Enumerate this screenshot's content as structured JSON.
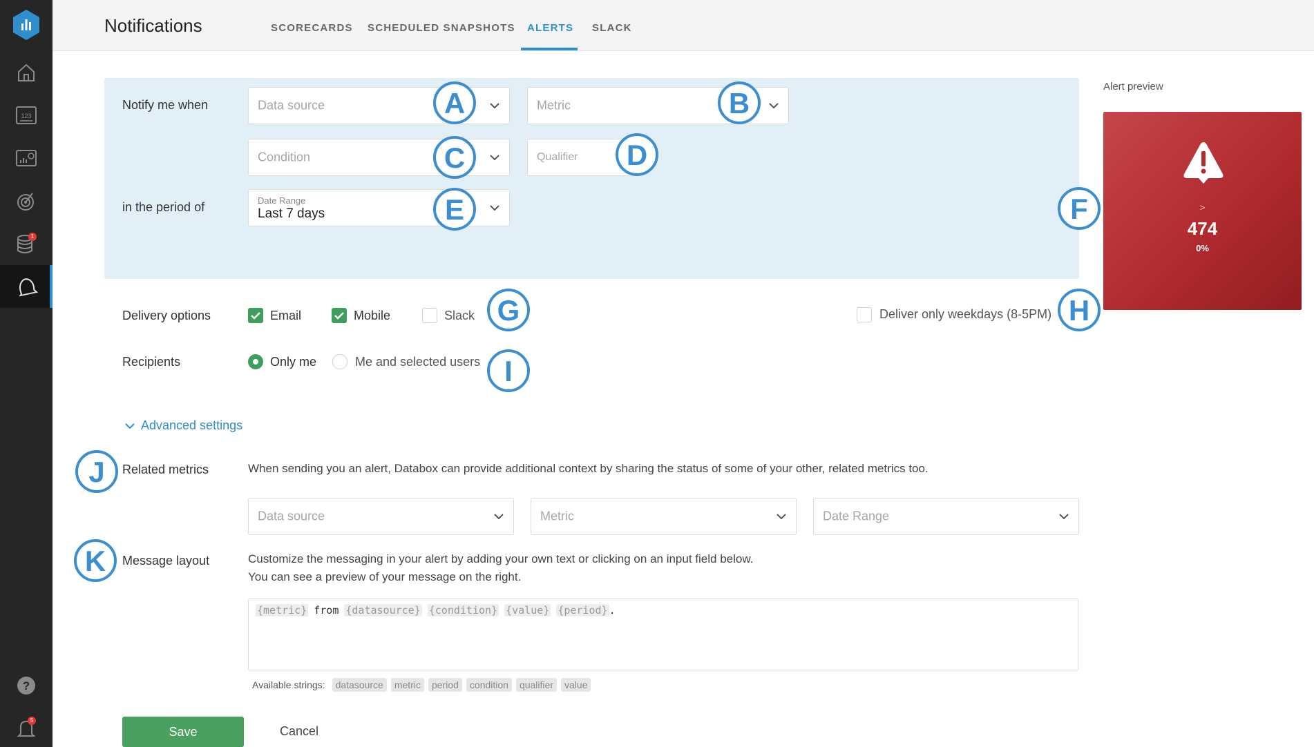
{
  "header": {
    "title": "Notifications",
    "tabs": [
      {
        "label": "SCORECARDS",
        "active": false
      },
      {
        "label": "SCHEDULED SNAPSHOTS",
        "active": false
      },
      {
        "label": "ALERTS",
        "active": true
      },
      {
        "label": "SLACK",
        "active": false
      }
    ]
  },
  "sidebar": {
    "items": [
      {
        "icon": "home-icon"
      },
      {
        "icon": "scorecard-icon"
      },
      {
        "icon": "dashboard-icon"
      },
      {
        "icon": "goals-icon"
      },
      {
        "icon": "datasource-icon",
        "badge": "1"
      },
      {
        "icon": "alerts-bell-icon",
        "active": true
      }
    ],
    "bottom": [
      {
        "icon": "help-icon"
      },
      {
        "icon": "notifications-icon",
        "badge": "5"
      }
    ]
  },
  "form": {
    "notify_label": "Notify me when",
    "period_label": "in the period of",
    "data_source_placeholder": "Data source",
    "metric_placeholder": "Metric",
    "condition_placeholder": "Condition",
    "qualifier_placeholder": "Qualifier",
    "date_range_label": "Date Range",
    "date_range_value": "Last 7 days"
  },
  "callouts": [
    "A",
    "B",
    "C",
    "D",
    "E",
    "F",
    "G",
    "H",
    "I",
    "J",
    "K"
  ],
  "preview": {
    "label": "Alert preview",
    "operator": ">",
    "value": "474",
    "percent": "0%",
    "color": "#b12b2f"
  },
  "delivery": {
    "label": "Delivery options",
    "email": {
      "label": "Email",
      "checked": true
    },
    "mobile": {
      "label": "Mobile",
      "checked": true
    },
    "slack": {
      "label": "Slack",
      "checked": false
    },
    "weekdays": {
      "label": "Deliver only weekdays (8-5PM)",
      "checked": false
    }
  },
  "recipients": {
    "label": "Recipients",
    "only_me": "Only me",
    "selected_users": "Me and selected users",
    "selected": "only_me"
  },
  "advanced": {
    "toggle_label": "Advanced settings",
    "related_label": "Related metrics",
    "related_desc": "When sending you an alert, Databox can provide additional context by sharing the status of some of your other, related metrics too.",
    "data_source_placeholder": "Data source",
    "metric_placeholder": "Metric",
    "date_range_placeholder": "Date Range",
    "message_label": "Message layout",
    "message_desc_1": "Customize the messaging in your alert by adding your own text or clicking on an input field below.",
    "message_desc_2": "You can see a preview of your message on the right.",
    "message_tokens": [
      "{metric}",
      "from",
      "{datasource}",
      "{condition}",
      "{value}",
      "{period}",
      "."
    ],
    "available_label": "Available strings:",
    "available_strings": [
      "datasource",
      "metric",
      "period",
      "condition",
      "qualifier",
      "value"
    ]
  },
  "actions": {
    "save": "Save",
    "cancel": "Cancel"
  },
  "colors": {
    "accent": "#2f8fce",
    "callout": "#3d8ed0",
    "success": "#49a05f",
    "panel": "#e3eff6"
  }
}
